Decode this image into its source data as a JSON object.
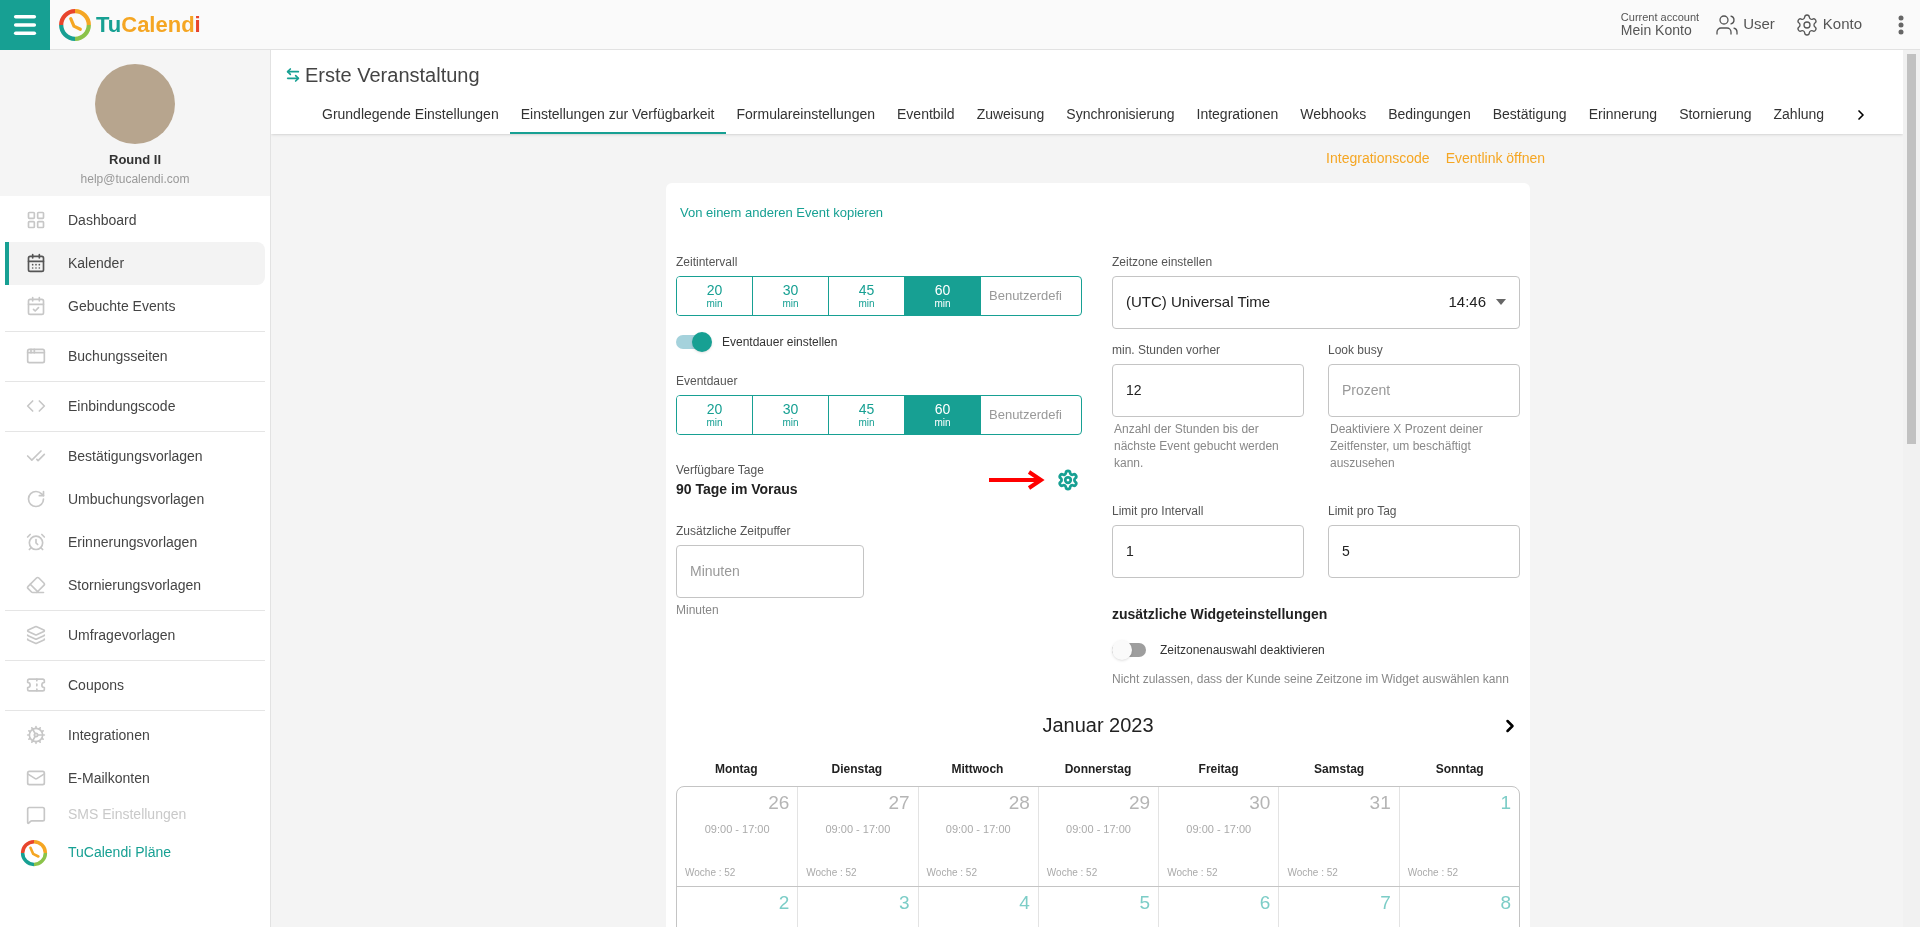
{
  "header": {
    "logo": [
      {
        "text": "Tu",
        "color": "#17a093"
      },
      {
        "text": "Calend",
        "color": "#f5a623"
      },
      {
        "text": "i",
        "color": "#e8452c"
      }
    ],
    "account": {
      "caption": "Current account",
      "name": "Mein Konto"
    },
    "actions": [
      "User",
      "Konto"
    ]
  },
  "sidebar": {
    "profile": {
      "name": "Round II",
      "email": "help@tucalendi.com"
    },
    "groups": [
      [
        {
          "label": "Dashboard",
          "selected": false,
          "disabled": false
        },
        {
          "label": "Kalender",
          "selected": true,
          "disabled": false
        },
        {
          "label": "Gebuchte Events",
          "selected": false,
          "disabled": false
        }
      ],
      [
        {
          "label": "Buchungsseiten",
          "selected": false,
          "disabled": false
        }
      ],
      [
        {
          "label": "Einbindungscode",
          "selected": false,
          "disabled": false
        }
      ],
      [
        {
          "label": "Bestätigungsvorlagen",
          "selected": false,
          "disabled": false
        },
        {
          "label": "Umbuchungsvorlagen",
          "selected": false,
          "disabled": false
        },
        {
          "label": "Erinnerungsvorlagen",
          "selected": false,
          "disabled": false
        },
        {
          "label": "Stornierungsvorlagen",
          "selected": false,
          "disabled": false
        }
      ],
      [
        {
          "label": "Umfragevorlagen",
          "selected": false,
          "disabled": false
        }
      ],
      [
        {
          "label": "Coupons",
          "selected": false,
          "disabled": false
        }
      ],
      [
        {
          "label": "Integrationen",
          "selected": false,
          "disabled": false
        },
        {
          "label": "E-Mailkonten",
          "selected": false,
          "disabled": false
        },
        {
          "label": "SMS Einstellungen",
          "selected": false,
          "disabled": true
        }
      ]
    ],
    "plans": "TuCalendi Pläne"
  },
  "page": {
    "title": "Erste Veranstaltung",
    "tabs": [
      {
        "label": "Grundlegende Einstellungen",
        "selected": false
      },
      {
        "label": "Einstellungen zur Verfügbarkeit",
        "selected": true
      },
      {
        "label": "Formulareinstellungen",
        "selected": false
      },
      {
        "label": "Eventbild",
        "selected": false
      },
      {
        "label": "Zuweisung",
        "selected": false
      },
      {
        "label": "Synchronisierung",
        "selected": false
      },
      {
        "label": "Integrationen",
        "selected": false
      },
      {
        "label": "Webhooks",
        "selected": false
      },
      {
        "label": "Bedingungen",
        "selected": false
      },
      {
        "label": "Bestätigung",
        "selected": false
      },
      {
        "label": "Erinnerung",
        "selected": false
      },
      {
        "label": "Stornierung",
        "selected": false
      },
      {
        "label": "Zahlung",
        "selected": false
      }
    ],
    "links": [
      "Integrationscode",
      "Eventlink öffnen"
    ]
  },
  "form": {
    "copy_link": "Von einem anderen Event kopieren",
    "interval": {
      "label": "Zeitintervall",
      "options": [
        {
          "value": "20",
          "unit": "min",
          "selected": false
        },
        {
          "value": "30",
          "unit": "min",
          "selected": false
        },
        {
          "value": "45",
          "unit": "min",
          "selected": false
        },
        {
          "value": "60",
          "unit": "min",
          "selected": true
        }
      ],
      "custom_placeholder": "Benutzerdefi"
    },
    "duration_toggle": {
      "label": "Eventdauer einstellen",
      "on": true
    },
    "duration": {
      "label": "Eventdauer",
      "options": [
        {
          "value": "20",
          "unit": "min",
          "selected": false
        },
        {
          "value": "30",
          "unit": "min",
          "selected": false
        },
        {
          "value": "45",
          "unit": "min",
          "selected": false
        },
        {
          "value": "60",
          "unit": "min",
          "selected": true
        }
      ],
      "custom_placeholder": "Benutzerdefi"
    },
    "available_days": {
      "label": "Verfügbare Tage",
      "value": "90 Tage im Voraus"
    },
    "buffer": {
      "label": "Zusätzliche Zeitpuffer",
      "placeholder": "Minuten",
      "hint": "Minuten"
    },
    "timezone": {
      "label": "Zeitzone einstellen",
      "value": "(UTC) Universal Time",
      "time": "14:46"
    },
    "min_hours": {
      "label": "min. Stunden vorher",
      "value": "12",
      "hint": "Anzahl der Stunden bis der nächste Event gebucht werden kann."
    },
    "look_busy": {
      "label": "Look busy",
      "placeholder": "Prozent",
      "hint": "Deaktiviere X Prozent deiner Zeitfenster, um beschäftigt auszusehen"
    },
    "limit_interval": {
      "label": "Limit pro Intervall",
      "value": "1"
    },
    "limit_day": {
      "label": "Limit pro Tag",
      "value": "5"
    },
    "widget_heading": "zusätzliche Widgeteinstellungen",
    "tz_toggle": {
      "label": "Zeitzonenauswahl deaktivieren",
      "on": false,
      "hint": "Nicht zulassen, dass der Kunde seine Zeitzone im Widget auswählen kann"
    }
  },
  "calendar": {
    "month": "Januar 2023",
    "weekdays": [
      "Montag",
      "Dienstag",
      "Mittwoch",
      "Donnerstag",
      "Freitag",
      "Samstag",
      "Sonntag"
    ],
    "weeks": [
      [
        {
          "day": "26",
          "in_month": false,
          "hours": "09:00 - 17:00",
          "week": "Woche : 52"
        },
        {
          "day": "27",
          "in_month": false,
          "hours": "09:00 - 17:00",
          "week": "Woche : 52"
        },
        {
          "day": "28",
          "in_month": false,
          "hours": "09:00 - 17:00",
          "week": "Woche : 52"
        },
        {
          "day": "29",
          "in_month": false,
          "hours": "09:00 - 17:00",
          "week": "Woche : 52"
        },
        {
          "day": "30",
          "in_month": false,
          "hours": "09:00 - 17:00",
          "week": "Woche : 52"
        },
        {
          "day": "31",
          "in_month": false,
          "week": "Woche : 52"
        },
        {
          "day": "1",
          "in_month": true,
          "week": "Woche : 52"
        }
      ],
      [
        {
          "day": "2",
          "in_month": true
        },
        {
          "day": "3",
          "in_month": true
        },
        {
          "day": "4",
          "in_month": true
        },
        {
          "day": "5",
          "in_month": true
        },
        {
          "day": "6",
          "in_month": true
        },
        {
          "day": "7",
          "in_month": true
        },
        {
          "day": "8",
          "in_month": true
        }
      ]
    ]
  }
}
